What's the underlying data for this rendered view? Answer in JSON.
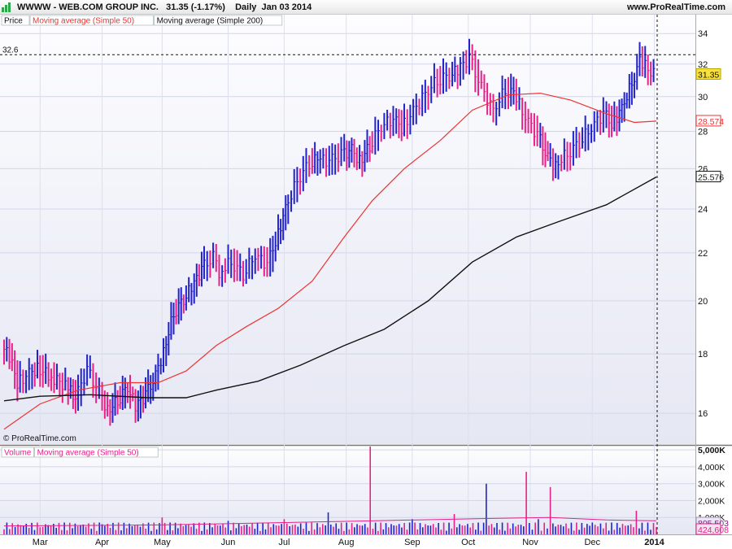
{
  "header": {
    "title": "WWWW - WEB.COM GROUP INC.   31.35 (-1.17%)    Daily  Jan 03 2014",
    "brand": "www.ProRealTime.com"
  },
  "watermark": "© ProRealTime.com",
  "colors": {
    "up": "#2222cc",
    "down": "#e8208a",
    "ma50": "#ee3333",
    "ma200": "#111111",
    "vol_ma": "#e8208a"
  },
  "chart_data": [
    {
      "type": "ohlc",
      "legend": [
        "Price",
        "Moving average (Simple 50)",
        "Moving average (Simple 200)"
      ],
      "yaxis": {
        "scale": "log",
        "ylim": [
          15.05,
          35.3
        ],
        "ticks": [
          16,
          18,
          20,
          22,
          24,
          26,
          28,
          30,
          32,
          34
        ]
      },
      "xaxis": {
        "ticks": [
          "Mar",
          "Apr",
          "May",
          "Jun",
          "Jul",
          "Aug",
          "Sep",
          "Oct",
          "Nov",
          "Dec",
          "2014"
        ]
      },
      "labels": {
        "crosshair": "32.6",
        "last": "31.35",
        "ma50": "28.574",
        "ma200": "25.576"
      },
      "series": {
        "price": [
          {
            "x": "2013-02-11",
            "close": 18.3
          },
          {
            "x": "2013-02-15",
            "close": 17.9
          },
          {
            "x": "2013-02-19",
            "close": 17.0
          },
          {
            "x": "2013-02-25",
            "close": 17.3
          },
          {
            "x": "2013-03-01",
            "close": 17.5
          },
          {
            "x": "2013-03-08",
            "close": 17.2
          },
          {
            "x": "2013-03-15",
            "close": 16.9
          },
          {
            "x": "2013-03-20",
            "close": 16.5
          },
          {
            "x": "2013-03-26",
            "close": 17.4
          },
          {
            "x": "2013-04-01",
            "close": 16.7
          },
          {
            "x": "2013-04-05",
            "close": 16.1
          },
          {
            "x": "2013-04-10",
            "close": 16.4
          },
          {
            "x": "2013-04-15",
            "close": 16.9
          },
          {
            "x": "2013-04-19",
            "close": 16.2
          },
          {
            "x": "2013-04-24",
            "close": 16.6
          },
          {
            "x": "2013-04-29",
            "close": 17.2
          },
          {
            "x": "2013-05-03",
            "close": 18.1
          },
          {
            "x": "2013-05-08",
            "close": 19.5
          },
          {
            "x": "2013-05-13",
            "close": 20.1
          },
          {
            "x": "2013-05-17",
            "close": 20.5
          },
          {
            "x": "2013-05-22",
            "close": 21.3
          },
          {
            "x": "2013-05-28",
            "close": 21.8
          },
          {
            "x": "2013-05-31",
            "close": 21.2
          },
          {
            "x": "2013-06-06",
            "close": 21.6
          },
          {
            "x": "2013-06-12",
            "close": 21.1
          },
          {
            "x": "2013-06-18",
            "close": 21.9
          },
          {
            "x": "2013-06-24",
            "close": 21.5
          },
          {
            "x": "2013-06-28",
            "close": 22.5
          },
          {
            "x": "2013-07-03",
            "close": 24.0
          },
          {
            "x": "2013-07-09",
            "close": 25.4
          },
          {
            "x": "2013-07-15",
            "close": 26.3
          },
          {
            "x": "2013-07-19",
            "close": 26.5
          },
          {
            "x": "2013-07-25",
            "close": 26.4
          },
          {
            "x": "2013-07-31",
            "close": 26.7
          },
          {
            "x": "2013-08-05",
            "close": 27.0
          },
          {
            "x": "2013-08-09",
            "close": 26.4
          },
          {
            "x": "2013-08-14",
            "close": 27.2
          },
          {
            "x": "2013-08-20",
            "close": 28.3
          },
          {
            "x": "2013-08-26",
            "close": 28.7
          },
          {
            "x": "2013-08-30",
            "close": 28.2
          },
          {
            "x": "2013-09-05",
            "close": 29.1
          },
          {
            "x": "2013-09-11",
            "close": 30.2
          },
          {
            "x": "2013-09-17",
            "close": 31.0
          },
          {
            "x": "2013-09-23",
            "close": 31.3
          },
          {
            "x": "2013-09-27",
            "close": 31.6
          },
          {
            "x": "2013-10-03",
            "close": 32.4
          },
          {
            "x": "2013-10-09",
            "close": 30.5
          },
          {
            "x": "2013-10-15",
            "close": 29.2
          },
          {
            "x": "2013-10-21",
            "close": 30.4
          },
          {
            "x": "2013-10-25",
            "close": 30.2
          },
          {
            "x": "2013-10-31",
            "close": 28.8
          },
          {
            "x": "2013-11-06",
            "close": 27.8
          },
          {
            "x": "2013-11-11",
            "close": 26.5
          },
          {
            "x": "2013-11-15",
            "close": 26.2
          },
          {
            "x": "2013-11-21",
            "close": 26.8
          },
          {
            "x": "2013-11-27",
            "close": 27.4
          },
          {
            "x": "2013-12-03",
            "close": 28.2
          },
          {
            "x": "2013-12-09",
            "close": 29.0
          },
          {
            "x": "2013-12-13",
            "close": 28.4
          },
          {
            "x": "2013-12-18",
            "close": 29.3
          },
          {
            "x": "2013-12-23",
            "close": 30.8
          },
          {
            "x": "2013-12-27",
            "close": 32.2
          },
          {
            "x": "2014-01-03",
            "close": 31.35
          }
        ],
        "ma50": [
          {
            "x": "2013-02-11",
            "y": 15.5
          },
          {
            "x": "2013-03-01",
            "y": 16.3
          },
          {
            "x": "2013-03-20",
            "y": 16.75
          },
          {
            "x": "2013-04-10",
            "y": 17.0
          },
          {
            "x": "2013-04-29",
            "y": 17.0
          },
          {
            "x": "2013-05-13",
            "y": 17.4
          },
          {
            "x": "2013-05-28",
            "y": 18.3
          },
          {
            "x": "2013-06-12",
            "y": 19.0
          },
          {
            "x": "2013-06-28",
            "y": 19.7
          },
          {
            "x": "2013-07-15",
            "y": 20.8
          },
          {
            "x": "2013-07-31",
            "y": 22.7
          },
          {
            "x": "2013-08-14",
            "y": 24.4
          },
          {
            "x": "2013-08-30",
            "y": 26.0
          },
          {
            "x": "2013-09-17",
            "y": 27.5
          },
          {
            "x": "2013-10-03",
            "y": 29.2
          },
          {
            "x": "2013-10-21",
            "y": 30.1
          },
          {
            "x": "2013-11-06",
            "y": 30.2
          },
          {
            "x": "2013-11-21",
            "y": 29.8
          },
          {
            "x": "2013-12-09",
            "y": 29.0
          },
          {
            "x": "2013-12-23",
            "y": 28.5
          },
          {
            "x": "2014-01-03",
            "y": 28.574
          }
        ],
        "ma200": [
          {
            "x": "2013-02-11",
            "y": 16.4
          },
          {
            "x": "2013-03-01",
            "y": 16.55
          },
          {
            "x": "2013-03-26",
            "y": 16.6
          },
          {
            "x": "2013-04-24",
            "y": 16.5
          },
          {
            "x": "2013-05-13",
            "y": 16.5
          },
          {
            "x": "2013-05-28",
            "y": 16.75
          },
          {
            "x": "2013-06-18",
            "y": 17.05
          },
          {
            "x": "2013-07-09",
            "y": 17.6
          },
          {
            "x": "2013-07-31",
            "y": 18.3
          },
          {
            "x": "2013-08-20",
            "y": 18.9
          },
          {
            "x": "2013-09-11",
            "y": 20.0
          },
          {
            "x": "2013-10-03",
            "y": 21.6
          },
          {
            "x": "2013-10-25",
            "y": 22.7
          },
          {
            "x": "2013-11-15",
            "y": 23.4
          },
          {
            "x": "2013-12-09",
            "y": 24.2
          },
          {
            "x": "2014-01-03",
            "y": 25.576
          }
        ]
      }
    },
    {
      "type": "bar",
      "legend": [
        "Volume",
        "Moving average (Simple 50)"
      ],
      "yaxis": {
        "ticks": [
          "1,000K",
          "2,000K",
          "3,000K",
          "4,000K",
          "5,000K"
        ],
        "ylim": [
          0,
          5200
        ]
      },
      "labels": {
        "vol_ma": "805,503",
        "last": "424,608"
      },
      "series": {
        "volume": [
          {
            "x": "2013-02-11",
            "y": 300
          },
          {
            "x": "2013-03-01",
            "y": 420
          },
          {
            "x": "2013-04-01",
            "y": 600
          },
          {
            "x": "2013-05-01",
            "y": 1000
          },
          {
            "x": "2013-06-03",
            "y": 800
          },
          {
            "x": "2013-07-01",
            "y": 900
          },
          {
            "x": "2013-07-23",
            "y": 1300
          },
          {
            "x": "2013-08-13",
            "y": 5200
          },
          {
            "x": "2013-09-03",
            "y": 900
          },
          {
            "x": "2013-09-24",
            "y": 1200
          },
          {
            "x": "2013-10-10",
            "y": 3000
          },
          {
            "x": "2013-10-30",
            "y": 3700
          },
          {
            "x": "2013-11-05",
            "y": 900
          },
          {
            "x": "2013-11-11",
            "y": 2800
          },
          {
            "x": "2013-12-02",
            "y": 700
          },
          {
            "x": "2013-12-24",
            "y": 1400
          },
          {
            "x": "2014-01-03",
            "y": 425
          }
        ],
        "vol_ma": [
          {
            "x": "2013-02-11",
            "y": 500
          },
          {
            "x": "2013-05-01",
            "y": 560
          },
          {
            "x": "2013-08-13",
            "y": 800
          },
          {
            "x": "2013-10-10",
            "y": 940
          },
          {
            "x": "2013-11-11",
            "y": 1000
          },
          {
            "x": "2013-12-09",
            "y": 850
          },
          {
            "x": "2014-01-03",
            "y": 805
          }
        ]
      }
    }
  ]
}
